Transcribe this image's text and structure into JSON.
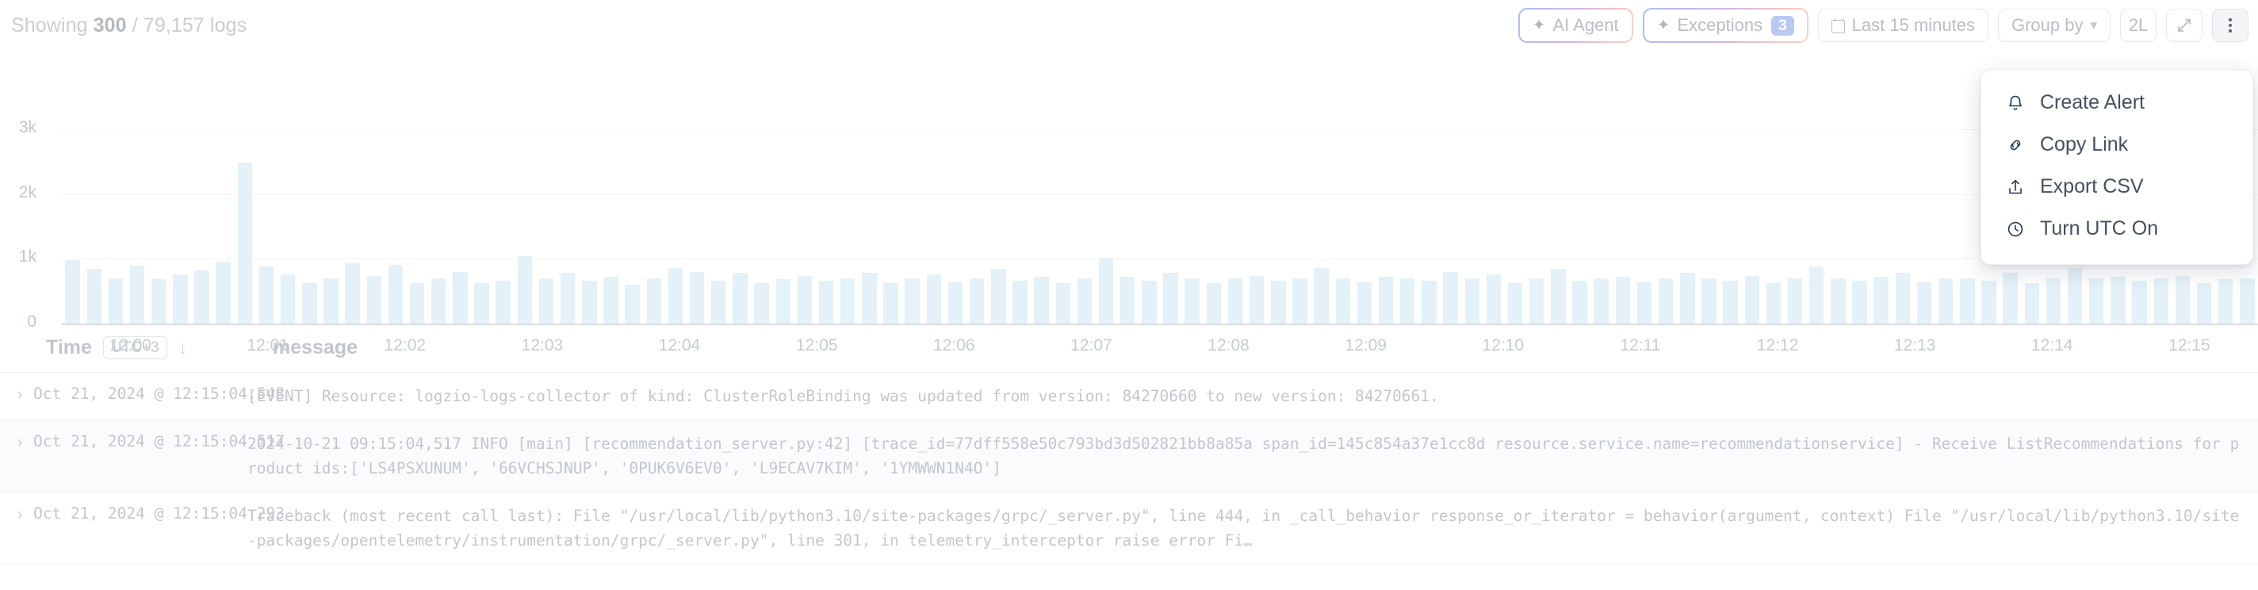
{
  "header": {
    "showing_prefix": "Showing ",
    "showing_count": "300",
    "showing_suffix": " / 79,157 logs"
  },
  "toolbar": {
    "ai_agent_label": "AI Agent",
    "ai_agent_icon": "sparkle-icon",
    "exceptions_label": "Exceptions",
    "exceptions_icon": "sparkle-icon",
    "exceptions_count": "3",
    "time_range_label": "Last 15 minutes",
    "time_range_icon": "calendar-icon",
    "group_by_label": "Group by",
    "group_by_icon": "chevron-down-icon",
    "density_label": "2L",
    "expand_icon": "expand-arrows-icon",
    "kebab_icon": "more-vertical-icon",
    "accent_gradient_from": "#aebcf5",
    "accent_gradient_to": "#fbd4c8",
    "badge_color": "#b9c9f2"
  },
  "menu": {
    "items": [
      {
        "label": "Create Alert",
        "icon": "bell-icon"
      },
      {
        "label": "Copy Link",
        "icon": "link-icon"
      },
      {
        "label": "Export CSV",
        "icon": "upload-icon"
      },
      {
        "label": "Turn UTC On",
        "icon": "clock-icon"
      }
    ]
  },
  "chart_data": {
    "type": "bar",
    "title": "",
    "xlabel": "",
    "ylabel": "",
    "ylim": [
      0,
      3000
    ],
    "ytick_labels": [
      "0",
      "1k",
      "2k",
      "3k"
    ],
    "yticks": [
      0,
      1000,
      2000,
      3000
    ],
    "grid": true,
    "legend": "none",
    "bar_color": "#e4f1f8",
    "xtick_labels": [
      "12:00",
      "12:01",
      "12:02",
      "12:03",
      "12:04",
      "12:05",
      "12:06",
      "12:07",
      "12:08",
      "12:09",
      "12:10",
      "12:11",
      "12:12",
      "12:13",
      "12:14",
      "12:15"
    ],
    "x_start": "12:00",
    "x_end": "12:15",
    "values": [
      980,
      840,
      700,
      900,
      690,
      760,
      820,
      960,
      2480,
      880,
      760,
      620,
      700,
      930,
      740,
      910,
      630,
      700,
      790,
      620,
      660,
      1040,
      700,
      780,
      660,
      720,
      600,
      700,
      860,
      800,
      660,
      780,
      620,
      690,
      740,
      660,
      700,
      780,
      620,
      700,
      760,
      640,
      700,
      840,
      660,
      720,
      620,
      700,
      1020,
      720,
      660,
      780,
      700,
      620,
      700,
      740,
      660,
      700,
      860,
      700,
      640,
      720,
      700,
      660,
      800,
      700,
      760,
      620,
      700,
      840,
      660,
      700,
      720,
      640,
      700,
      780,
      700,
      660,
      740,
      620,
      700,
      880,
      700,
      660,
      720,
      780,
      640,
      700,
      700,
      660,
      780,
      620,
      700,
      860,
      700,
      720,
      660,
      700,
      740,
      620,
      680,
      700
    ]
  },
  "table": {
    "columns": {
      "time": "Time",
      "timezone_badge": "UTC+3",
      "sort_direction_icon": "arrow-down-icon",
      "message": "message"
    },
    "rows": [
      {
        "time": "Oct 21, 2024 @ 12:15:04.548",
        "message": "[EVENT] Resource: logzio-logs-collector of kind: ClusterRoleBinding was updated from version: 84270660 to new version: 84270661."
      },
      {
        "time": "Oct 21, 2024 @ 12:15:04.517",
        "message": "2024-10-21 09:15:04,517 INFO [main] [recommendation_server.py:42] [trace_id=77dff558e50c793bd3d502821bb8a85a span_id=145c854a37e1cc8d resource.service.name=recommendationservice] - Receive ListRecommendations for product ids:['LS4PSXUNUM', '66VCHSJNUP', '0PUK6V6EV0', 'L9ECAV7KIM', '1YMWWN1N4O']"
      },
      {
        "time": "Oct 21, 2024 @ 12:15:04.293",
        "message": "Traceback (most recent call last): File \"/usr/local/lib/python3.10/site-packages/grpc/_server.py\", line 444, in _call_behavior response_or_iterator = behavior(argument, context) File \"/usr/local/lib/python3.10/site-packages/opentelemetry/instrumentation/grpc/_server.py\", line 301, in telemetry_interceptor raise error Fi…"
      }
    ]
  }
}
